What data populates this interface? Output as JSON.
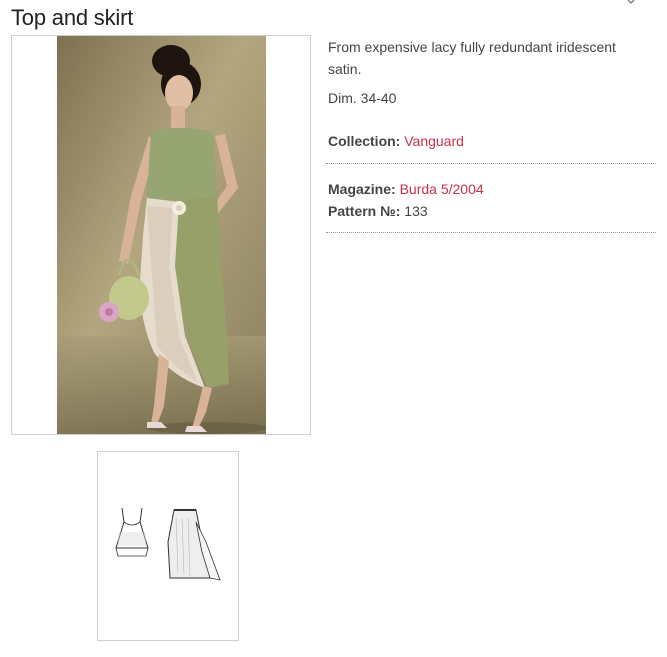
{
  "product": {
    "title": "Top and skirt",
    "description": "From expensive lacy fully redundant iridescent satin.",
    "dimensions": "Dim. 34-40",
    "collection_label": "Collection:",
    "collection_value": "Vanguard",
    "magazine_label": "Magazine:",
    "magazine_value": "Burda 5/2004",
    "pattern_label": "Pattern №:",
    "pattern_value": "133"
  },
  "colors": {
    "link": "#c6314b",
    "photo_background": "#a79c76",
    "top_green": "#8e9e6c",
    "skirt_green": "#9aa56e",
    "lace": "#e6dccd"
  },
  "icons": {
    "main_photo": "fashion-photo",
    "sketch": "technical-drawing"
  }
}
